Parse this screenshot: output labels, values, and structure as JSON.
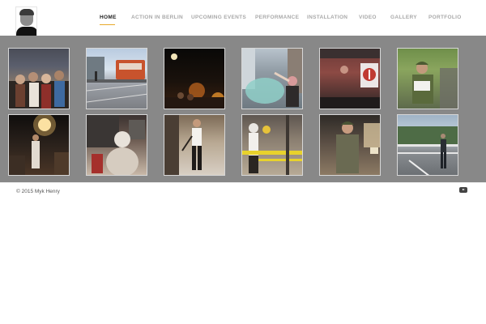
{
  "nav": {
    "items": [
      {
        "label": "HOME",
        "active": true
      },
      {
        "label": "ACTION IN BERLIN",
        "active": false
      },
      {
        "label": "UPCOMING EVENTS",
        "active": false
      },
      {
        "label": "PERFORMANCE",
        "active": false
      },
      {
        "label": "INSTALLATION",
        "active": false
      },
      {
        "label": "VIDEO",
        "active": false
      },
      {
        "label": "GALLERY",
        "active": false
      },
      {
        "label": "PORTFOLIO",
        "active": false
      }
    ]
  },
  "footer": {
    "copyright": "© 2015 Myk Henry",
    "social_icon": "youtube-icon"
  },
  "colors": {
    "accent": "#e8a92b",
    "gallery_background": "#888888"
  }
}
